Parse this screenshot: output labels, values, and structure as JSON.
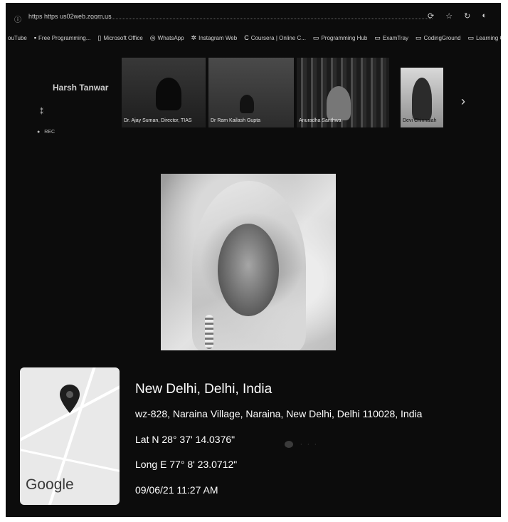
{
  "browser": {
    "url": "https https us02web.zoom.us",
    "toolbar_icons": [
      "extension-icon",
      "star-icon",
      "refresh-icon",
      "profile-icon"
    ]
  },
  "bookmarks": [
    {
      "label": "ouTube",
      "icon": "youtube-icon"
    },
    {
      "label": "Free Programming...",
      "icon": "bookmark-icon"
    },
    {
      "label": "Microsoft Office",
      "icon": "office-icon"
    },
    {
      "label": "WhatsApp",
      "icon": "whatsapp-icon"
    },
    {
      "label": "Instagram Web",
      "icon": "instagram-icon"
    },
    {
      "label": "Coursera | Online C...",
      "icon": "coursera-icon"
    },
    {
      "label": "Programming Hub",
      "icon": "page-icon"
    },
    {
      "label": "ExamTray",
      "icon": "page-icon"
    },
    {
      "label": "CodingGround",
      "icon": "page-icon"
    },
    {
      "label": "Learning Online Certi...",
      "icon": "page-icon"
    }
  ],
  "meeting": {
    "host_name": "Harsh Tanwar",
    "rec_label": "REC",
    "participants": [
      {
        "name": "Dr. Ajay Suman, Director, TIAS"
      },
      {
        "name": "Dr Ram Kailash Gupta"
      },
      {
        "name": "Anuradha Santhwa"
      },
      {
        "name": "Devi Chinnaiah"
      }
    ]
  },
  "location": {
    "city": "New Delhi, Delhi, India",
    "address": "wz-828, Naraina Village, Naraina, New Delhi, Delhi 110028, India",
    "lat": "Lat N 28° 37' 14.0376\"",
    "long": "Long E 77° 8' 23.0712\"",
    "datetime": "09/06/21 11:27 AM",
    "map_brand": "Google"
  },
  "colors": {
    "background": "#0c0c0c",
    "text": "#ffffff",
    "map": "#e9e9e9"
  }
}
